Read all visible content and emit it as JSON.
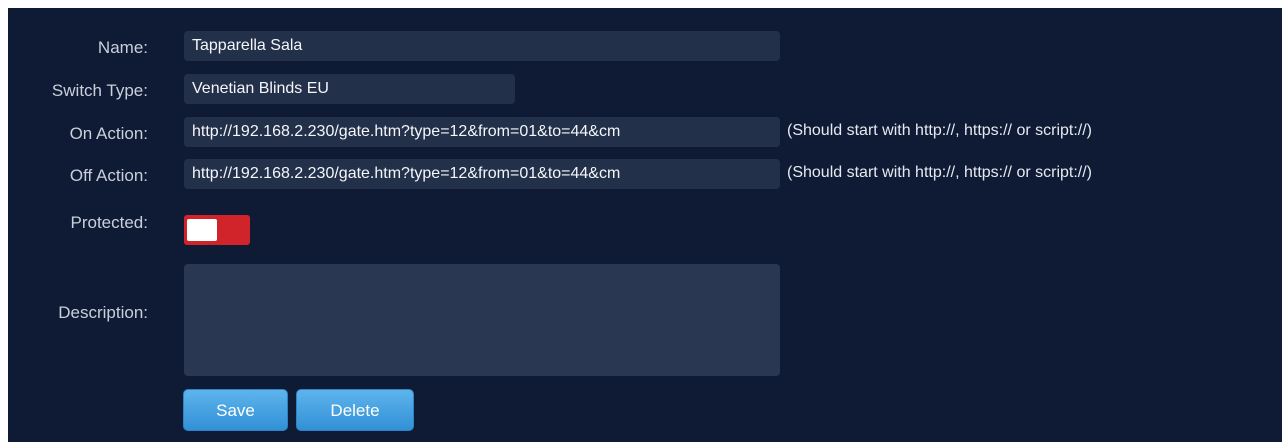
{
  "form": {
    "name": {
      "label": "Name:",
      "value": "Tapparella Sala"
    },
    "switch_type": {
      "label": "Switch Type:",
      "value": "Venetian Blinds EU"
    },
    "on_action": {
      "label": "On Action:",
      "value": "http://192.168.2.230/gate.htm?type=12&from=01&to=44&cm",
      "hint": "(Should start with http://, https:// or script://)"
    },
    "off_action": {
      "label": "Off Action:",
      "value": "http://192.168.2.230/gate.htm?type=12&from=01&to=44&cm",
      "hint": "(Should start with http://, https:// or script://)"
    },
    "protected": {
      "label": "Protected:",
      "state": "off"
    },
    "description": {
      "label": "Description:",
      "value": ""
    }
  },
  "buttons": {
    "save": "Save",
    "delete": "Delete"
  },
  "colors": {
    "panel_bg": "#0f1b35",
    "field_bg": "#233049",
    "toggle_off": "#d1242a",
    "button": "#3f9fe0"
  }
}
